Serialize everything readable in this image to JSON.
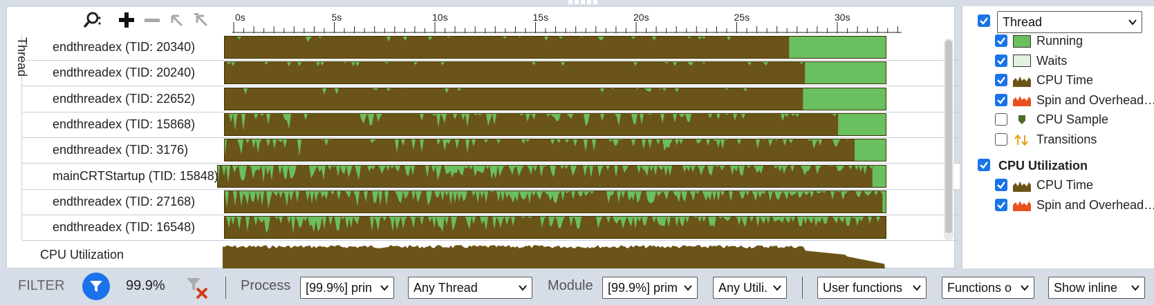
{
  "toolbar": {
    "search_icon": "search-icon",
    "add_icon": "plus-icon",
    "remove_icon": "minus-icon"
  },
  "ruler": {
    "ticks": [
      "0s",
      "5s",
      "10s",
      "15s",
      "20s",
      "25s",
      "30s"
    ]
  },
  "rail": {
    "label": "Thread"
  },
  "rows": [
    {
      "label": "endthreadex (TID: 20340)",
      "running_from": 0.852
    },
    {
      "label": "endthreadex (TID: 20240)",
      "running_from": 0.876
    },
    {
      "label": "endthreadex (TID: 22652)",
      "running_from": 0.873
    },
    {
      "label": "endthreadex (TID: 15868)",
      "running_from": 0.926
    },
    {
      "label": "endthreadex (TID: 3176)",
      "running_from": 0.951
    },
    {
      "label": "mainCRTStartup (TID: 15848)",
      "running_from": 0.978
    },
    {
      "label": "endthreadex (TID: 27168)",
      "running_from": 0.993
    },
    {
      "label": "endthreadex (TID: 16548)",
      "running_from": 0.998
    }
  ],
  "cpu_row": {
    "label": "CPU Utilization"
  },
  "legend": {
    "group_select": "Thread",
    "items": [
      {
        "label": "Running",
        "checked": true,
        "icon": "running-swatch"
      },
      {
        "label": "Waits",
        "checked": true,
        "icon": "waits-swatch"
      },
      {
        "label": "CPU Time",
        "checked": true,
        "icon": "cpu-time-icon"
      },
      {
        "label": "Spin and Overhead…",
        "checked": true,
        "icon": "spin-overhead-icon"
      },
      {
        "label": "CPU Sample",
        "checked": false,
        "icon": "cpu-sample-icon"
      },
      {
        "label": "Transitions",
        "checked": false,
        "icon": "transitions-icon"
      }
    ],
    "cpu_group": {
      "title": "CPU Utilization",
      "items": [
        {
          "label": "CPU Time",
          "checked": true
        },
        {
          "label": "Spin and Overhead…",
          "checked": true
        }
      ]
    }
  },
  "filter": {
    "label": "FILTER",
    "percent": "99.9%",
    "process_label": "Process",
    "process_value": "[99.9%] prin",
    "thread_value": "Any Thread",
    "module_label": "Module",
    "module_value": "[99.9%] prim",
    "util_value": "Any Utili.",
    "functions_value": "User functions",
    "functions2_value": "Functions o",
    "inline_value": "Show inline"
  },
  "colors": {
    "cpu": "#6b5417",
    "running": "#6abf5e",
    "accent": "#1a73e8",
    "spin": "#e8501e"
  }
}
